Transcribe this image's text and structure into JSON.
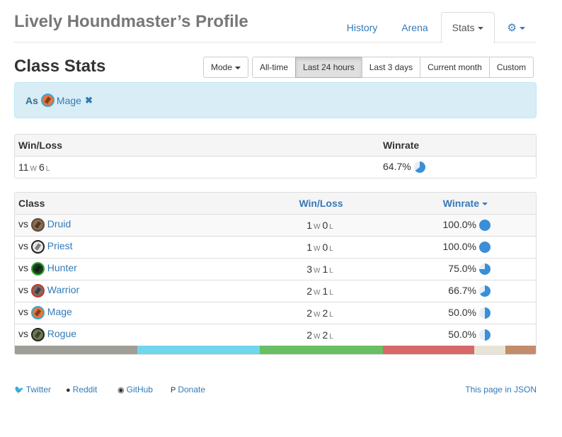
{
  "header": {
    "title": "Lively Houndmaster’s Profile",
    "tabs": [
      "History",
      "Arena",
      "Stats",
      ""
    ],
    "active_tab": "Stats"
  },
  "section": {
    "title": "Class Stats",
    "mode_label": "Mode",
    "ranges": [
      "All-time",
      "Last 24 hours",
      "Last 3 days",
      "Current month",
      "Custom"
    ],
    "active_range": "Last 24 hours"
  },
  "filter": {
    "as_label": "As",
    "class_name": "Mage",
    "remove_icon": "times-icon"
  },
  "summary": {
    "headers": [
      "Win/Loss",
      "Winrate"
    ],
    "wins": "11",
    "losses": "6",
    "win_suffix": "W",
    "loss_suffix": "L",
    "winrate": "64.7%",
    "winrate_value": 0.647
  },
  "classes_table": {
    "headers": [
      "Class",
      "Win/Loss",
      "Winrate"
    ],
    "vs_label": "vs",
    "rows": [
      {
        "class": "Druid",
        "icon": "druid",
        "wins": "1",
        "losses": "0",
        "winrate": "100.0%",
        "winrate_value": 1.0
      },
      {
        "class": "Priest",
        "icon": "priest",
        "wins": "1",
        "losses": "0",
        "winrate": "100.0%",
        "winrate_value": 1.0
      },
      {
        "class": "Hunter",
        "icon": "hunter",
        "wins": "3",
        "losses": "1",
        "winrate": "75.0%",
        "winrate_value": 0.75
      },
      {
        "class": "Warrior",
        "icon": "warrior",
        "wins": "2",
        "losses": "1",
        "winrate": "66.7%",
        "winrate_value": 0.667
      },
      {
        "class": "Mage",
        "icon": "mage",
        "wins": "2",
        "losses": "2",
        "winrate": "50.0%",
        "winrate_value": 0.5
      },
      {
        "class": "Rogue",
        "icon": "rogue",
        "wins": "2",
        "losses": "2",
        "winrate": "50.0%",
        "winrate_value": 0.5
      }
    ]
  },
  "color_bar": [
    {
      "color": "#9e9e96",
      "share": 0.2353
    },
    {
      "color": "#6fd6eb",
      "share": 0.2353
    },
    {
      "color": "#69bf63",
      "share": 0.2353
    },
    {
      "color": "#d8696a",
      "share": 0.1765
    },
    {
      "color": "#e8e3d5",
      "share": 0.0588
    },
    {
      "color": "#c38c6a",
      "share": 0.0588
    }
  ],
  "colors": {
    "pie_fill": "#3a8fd6",
    "pie_empty": "#e6eef7",
    "link": "#337ab7"
  },
  "footer": {
    "links": [
      {
        "label": "Twitter",
        "icon": "twitter-icon"
      },
      {
        "label": "Reddit",
        "icon": "reddit-icon"
      },
      {
        "label": "GitHub",
        "icon": "github-icon"
      },
      {
        "label": "Donate",
        "icon": "paypal-icon"
      }
    ],
    "json_link": "This page in JSON"
  }
}
